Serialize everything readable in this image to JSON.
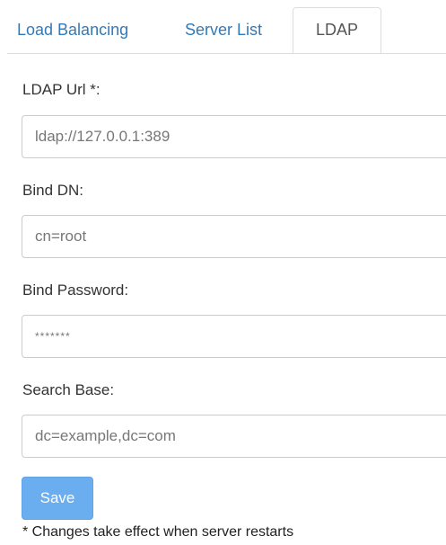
{
  "tabs": [
    {
      "label": "Load Balancing",
      "active": false
    },
    {
      "label": "Server List",
      "active": false
    },
    {
      "label": "LDAP",
      "active": true
    }
  ],
  "form": {
    "ldap_url": {
      "label": "LDAP Url *:",
      "placeholder": "ldap://127.0.0.1:389",
      "value": ""
    },
    "bind_dn": {
      "label": "Bind DN:",
      "placeholder": "cn=root",
      "value": ""
    },
    "bind_password": {
      "label": "Bind Password:",
      "placeholder": "*******",
      "value": ""
    },
    "search_base": {
      "label": "Search Base:",
      "placeholder": "dc=example,dc=com",
      "value": ""
    }
  },
  "actions": {
    "save_label": "Save"
  },
  "note": "* Changes take effect when server restarts",
  "colors": {
    "link": "#337ab7",
    "save_button": "#6aaef0",
    "border": "#cccccc"
  }
}
